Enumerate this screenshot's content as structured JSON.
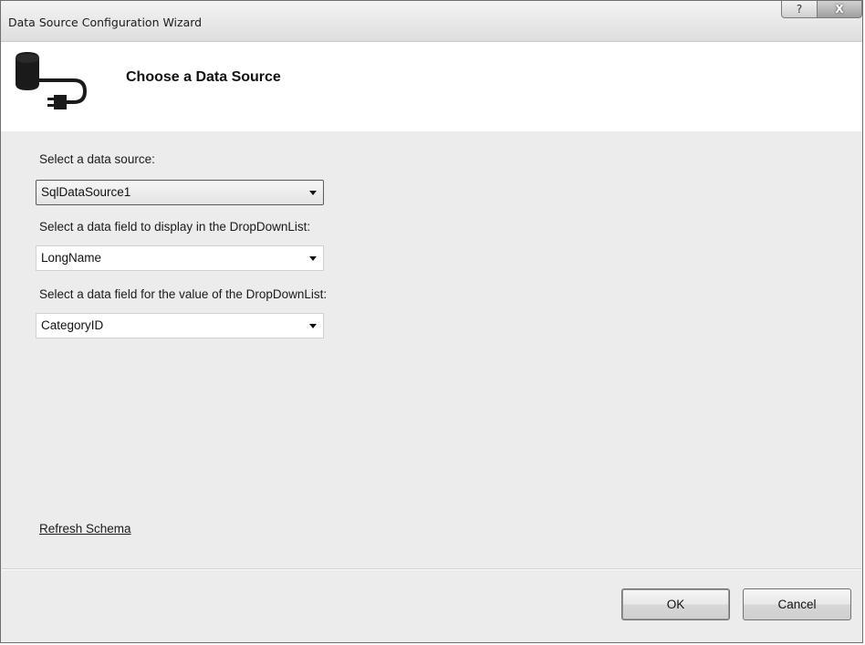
{
  "window": {
    "title": "Data Source Configuration Wizard",
    "help_glyph": "?",
    "close_glyph": "X"
  },
  "header": {
    "title": "Choose a Data Source",
    "icon": "database-plug-icon"
  },
  "fields": [
    {
      "label": "Select a data source:",
      "value": "SqlDataSource1"
    },
    {
      "label": "Select a data field to display in the DropDownList:",
      "value": "LongName"
    },
    {
      "label": "Select a data field for the value of the DropDownList:",
      "value": "CategoryID"
    }
  ],
  "links": {
    "refresh_schema": "Refresh Schema"
  },
  "buttons": {
    "ok": "OK",
    "cancel": "Cancel"
  }
}
